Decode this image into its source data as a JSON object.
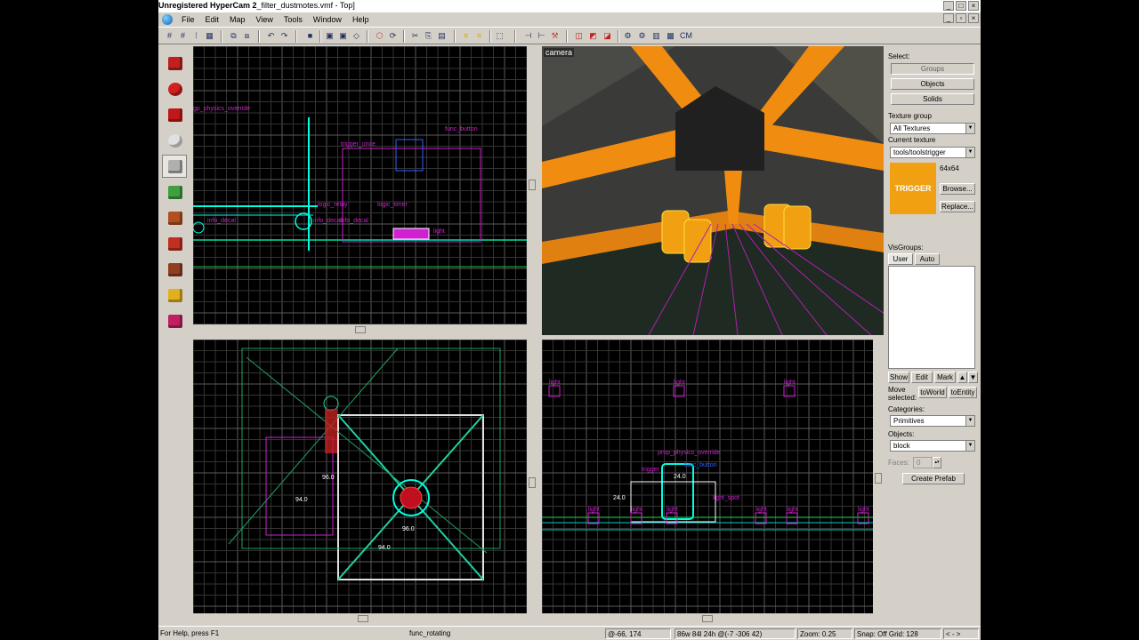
{
  "window": {
    "title_prefix": "Unregistered HyperCam 2",
    "title_doc": "_filter_dustmotes.vmf - Top]",
    "controls": [
      "_",
      "□",
      "×"
    ],
    "mdi_controls": [
      "_",
      "▫",
      "×"
    ]
  },
  "menu": [
    "File",
    "Edit",
    "Map",
    "View",
    "Tools",
    "Window",
    "Help"
  ],
  "toolbar": {
    "camera_label": "CM"
  },
  "tools": [
    {
      "name": "selection-tool",
      "color": "#c02020"
    },
    {
      "name": "magnify-tool",
      "color": "#d02020"
    },
    {
      "name": "camera-tool",
      "color": "#c01818"
    },
    {
      "name": "entity-tool",
      "color": "#e0e0e0"
    },
    {
      "name": "block-tool",
      "color": "#b0b0b0"
    },
    {
      "name": "texture-tool",
      "color": "#40a040"
    },
    {
      "name": "apply-texture-tool",
      "color": "#b05020"
    },
    {
      "name": "decal-tool",
      "color": "#c03020"
    },
    {
      "name": "overlay-tool",
      "color": "#904020"
    },
    {
      "name": "clip-tool",
      "color": "#e0b020"
    },
    {
      "name": "vertex-tool",
      "color": "#c02060"
    }
  ],
  "viewports": {
    "top_left": {
      "labels": [
        "gp_physics_override",
        "func_button",
        "trigger_once",
        "logic_timer",
        "info_decal",
        "info_decal",
        "info_decal",
        "logic_relay",
        "light"
      ]
    },
    "camera": {
      "label": "camera"
    },
    "bottom_left": {
      "dims": [
        "96.0",
        "94.0",
        "96.0",
        "94.0"
      ]
    },
    "bottom_right": {
      "labels": [
        "light",
        "light",
        "light",
        "light",
        "light",
        "light",
        "light",
        "light",
        "light",
        "prop_physics_override",
        "func_button",
        "trigger",
        "light_spot"
      ],
      "dims": [
        "24.0",
        "24.0"
      ]
    }
  },
  "right_panel": {
    "select_label": "Select:",
    "select_buttons": [
      "Groups",
      "Objects",
      "Solids"
    ],
    "texture_group_label": "Texture group",
    "texture_group_value": "All Textures",
    "current_texture_label": "Current texture",
    "current_texture_value": "tools/toolstrigger",
    "texture_size": "64x64",
    "texture_preview_text": "TRIGGER",
    "texture_color": "#f0a010",
    "browse": "Browse...",
    "replace": "Replace...",
    "visgroups_label": "VisGroups:",
    "vis_tabs": [
      "User",
      "Auto"
    ],
    "vis_buttons": [
      "Show",
      "Edit",
      "Mark"
    ],
    "move_selected_label": "Move selected:",
    "to_world": "toWorld",
    "to_entity": "toEntity",
    "categories_label": "Categories:",
    "categories_value": "Primitives",
    "objects_label": "Objects:",
    "objects_value": "block",
    "faces_label": "Faces:",
    "faces_value": "0",
    "create_prefab": "Create Prefab"
  },
  "status": {
    "help": "For Help, press F1",
    "selection": "func_rotating",
    "coords": "@-66, 174",
    "size": "86w 84l 24h @(-7 -306 42)",
    "zoom": "Zoom: 0.25",
    "snap": "Snap: Off Grid: 128",
    "nav": "< - >"
  }
}
